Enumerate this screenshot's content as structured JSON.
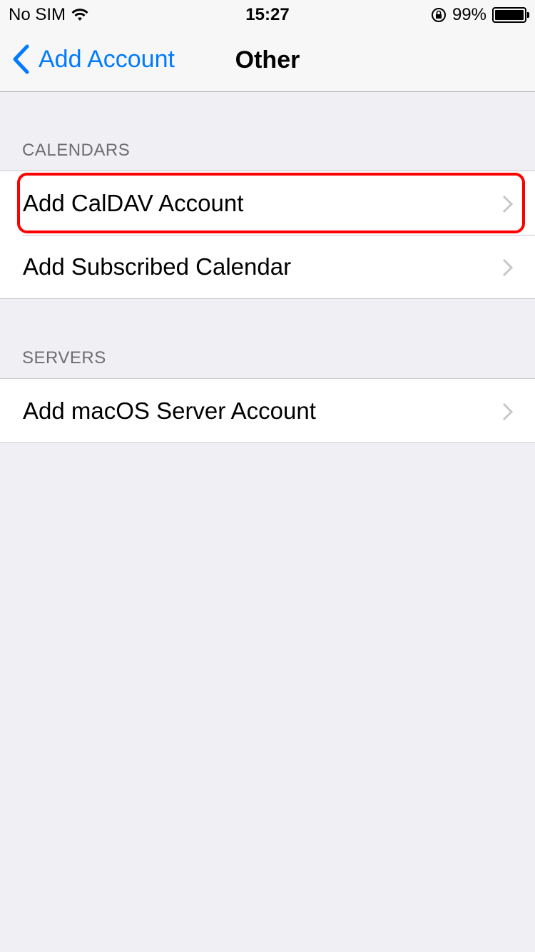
{
  "status_bar": {
    "carrier": "No SIM",
    "time": "15:27",
    "battery": "99%",
    "battery_level": 0.99
  },
  "nav": {
    "back_label": "Add Account",
    "title": "Other"
  },
  "sections": [
    {
      "header": "CALENDARS",
      "items": [
        {
          "label": "Add CalDAV Account",
          "highlighted": true
        },
        {
          "label": "Add Subscribed Calendar"
        }
      ]
    },
    {
      "header": "SERVERS",
      "items": [
        {
          "label": "Add macOS Server Account"
        }
      ]
    }
  ],
  "colors": {
    "accent": "#007aff",
    "highlight": "#ff0000",
    "background": "#efeff4"
  }
}
